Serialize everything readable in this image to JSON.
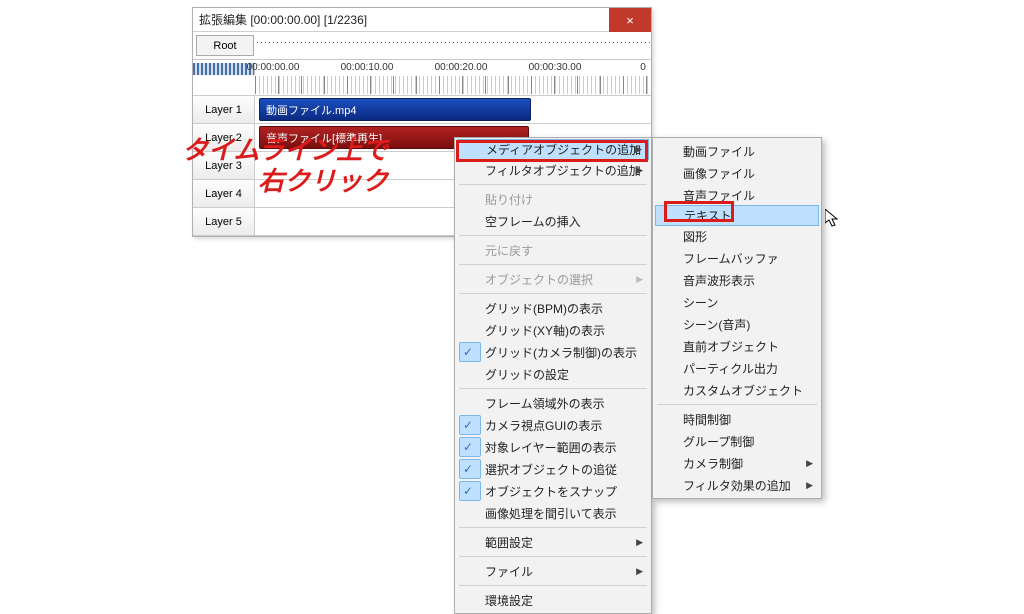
{
  "window": {
    "title": "拡張編集 [00:00:00.00] [1/2236]",
    "root_label": "Root",
    "close_label": "×"
  },
  "ruler": {
    "t0": "00:00:00.00",
    "t1": "00:00:10.00",
    "t2": "00:00:20.00",
    "t3": "00:00:30.00",
    "t4": "0"
  },
  "layers": {
    "l1": "Layer 1",
    "l2": "Layer 2",
    "l3": "Layer 3",
    "l4": "Layer 4",
    "l5": "Layer 5"
  },
  "clips": {
    "video": "動画ファイル.mp4",
    "audio": "音声ファイル[標準再生]"
  },
  "annotation": {
    "line1": "タイムライン上で",
    "line2": "右クリック"
  },
  "menu1": {
    "media_obj_add": "メディアオブジェクトの追加",
    "filter_obj_add": "フィルタオブジェクトの追加",
    "paste": "貼り付け",
    "empty_frame": "空フレームの挿入",
    "undo": "元に戻す",
    "obj_select": "オブジェクトの選択",
    "grid_bpm": "グリッド(BPM)の表示",
    "grid_xy": "グリッド(XY軸)の表示",
    "grid_camera": "グリッド(カメラ制御)の表示",
    "grid_setting": "グリッドの設定",
    "frame_outside": "フレーム領域外の表示",
    "camera_gui": "カメラ視点GUIの表示",
    "target_layer": "対象レイヤー範囲の表示",
    "track_select": "選択オブジェクトの追従",
    "snap": "オブジェクトをスナップ",
    "thin_display": "画像処理を間引いて表示",
    "range_setting": "範囲設定",
    "file": "ファイル",
    "env_setting": "環境設定"
  },
  "menu2": {
    "video_file": "動画ファイル",
    "image_file": "画像ファイル",
    "audio_file": "音声ファイル",
    "text": "テキスト",
    "figure": "図形",
    "frame_buffer": "フレームバッファ",
    "waveform": "音声波形表示",
    "scene": "シーン",
    "scene_audio": "シーン(音声)",
    "prev_obj": "直前オブジェクト",
    "particle": "パーティクル出力",
    "custom_obj": "カスタムオブジェクト",
    "time_ctrl": "時間制御",
    "group_ctrl": "グループ制御",
    "camera_ctrl": "カメラ制御",
    "filter_add": "フィルタ効果の追加"
  }
}
